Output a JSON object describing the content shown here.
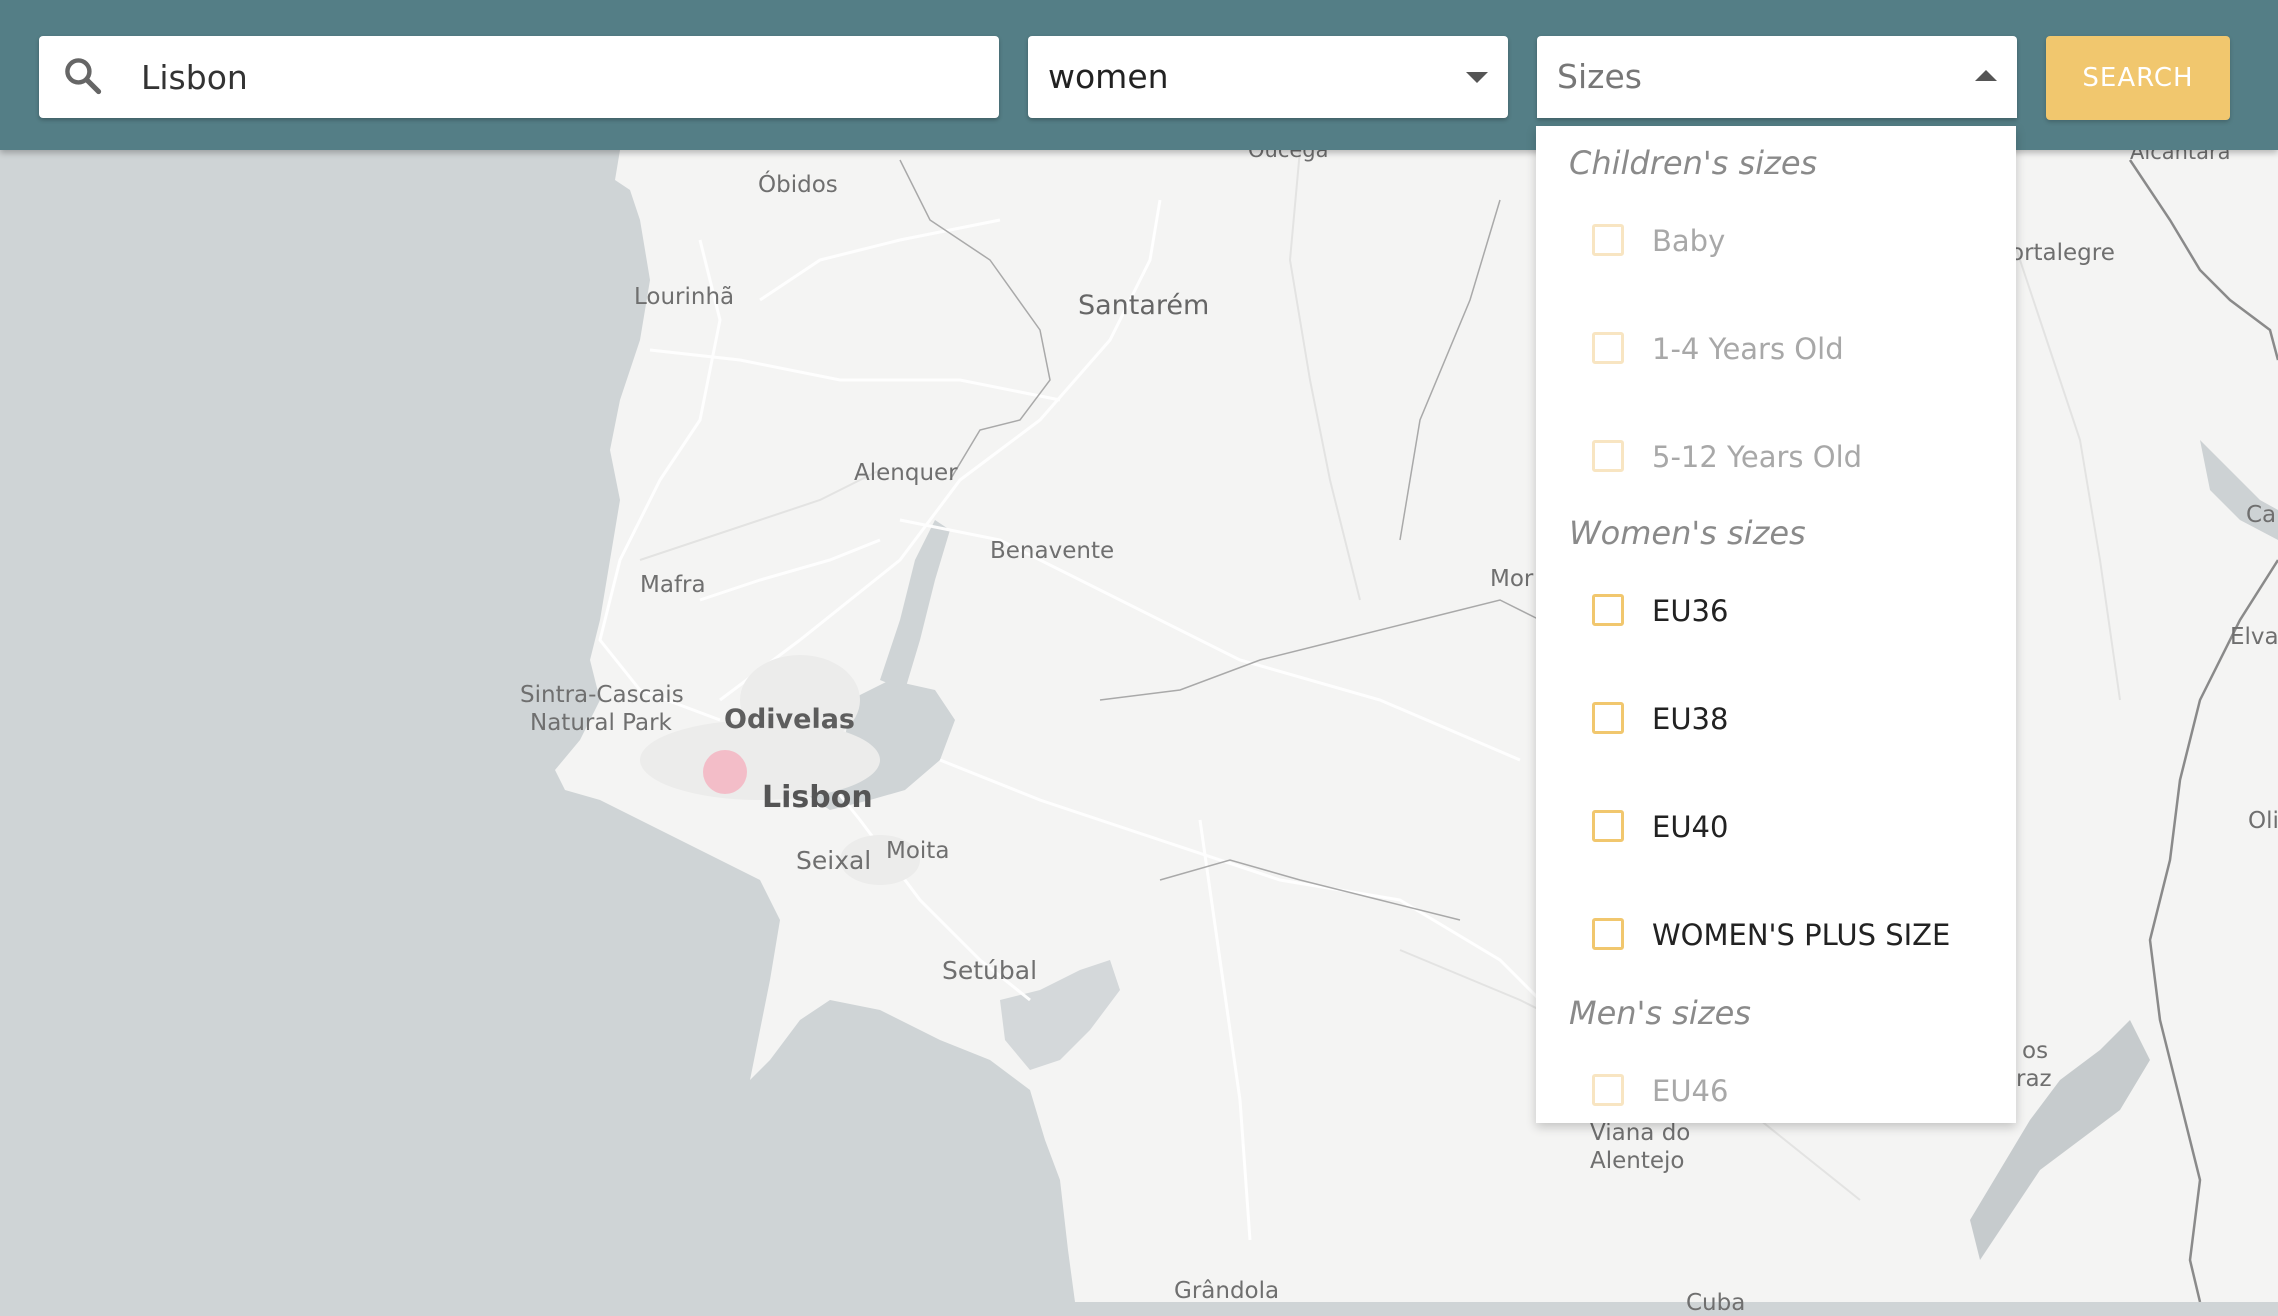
{
  "search": {
    "value": "Lisbon",
    "icon": "search-icon"
  },
  "category_select": {
    "value": "women",
    "icon": "caret-down-icon"
  },
  "sizes_select": {
    "value": "Sizes",
    "icon": "caret-up-icon",
    "open": true
  },
  "search_button": {
    "label": "SEARCH"
  },
  "colors": {
    "topbar": "#547e86",
    "accent": "#f1c76e",
    "marker": "#f4b8c4",
    "sea": "#cfd4d6",
    "land": "#f5f5f4"
  },
  "sizes_dropdown": {
    "groups": [
      {
        "title": "Children's sizes",
        "options": [
          {
            "label": "Baby",
            "enabled": false
          },
          {
            "label": "1-4 Years Old",
            "enabled": false
          },
          {
            "label": "5-12 Years Old",
            "enabled": false
          }
        ]
      },
      {
        "title": "Women's sizes",
        "options": [
          {
            "label": "EU36",
            "enabled": true
          },
          {
            "label": "EU38",
            "enabled": true
          },
          {
            "label": "EU40",
            "enabled": true
          },
          {
            "label": "WOMEN'S PLUS SIZE",
            "enabled": true
          }
        ]
      },
      {
        "title": "Men's sizes",
        "options": [
          {
            "label": "EU46",
            "enabled": false
          }
        ]
      }
    ]
  },
  "map": {
    "labels": {
      "obidos": "Óbidos",
      "lourinha": "Lourinhã",
      "santarem": "Santarém",
      "alenquer": "Alenquer",
      "benavente": "Benavente",
      "mafra": "Mafra",
      "sintra1": "Sintra-Cascais",
      "sintra2": "Natural Park",
      "odivelas": "Odivelas",
      "lisbon": "Lisbon",
      "seixal": "Seixal",
      "moita": "Moita",
      "setubal": "Setúbal",
      "viana1": "Viana do",
      "viana2": "Alentejo",
      "grandola": "Grândola",
      "portalegre": "ortalegre",
      "alcantara": "Alcantara",
      "elvas": "Elvas",
      "ouca": "Oucega",
      "mor": "Mor",
      "car": "Car",
      "oli": "Oli",
      "os": "os",
      "raz": "raz",
      "cuba": "Cuba"
    }
  }
}
